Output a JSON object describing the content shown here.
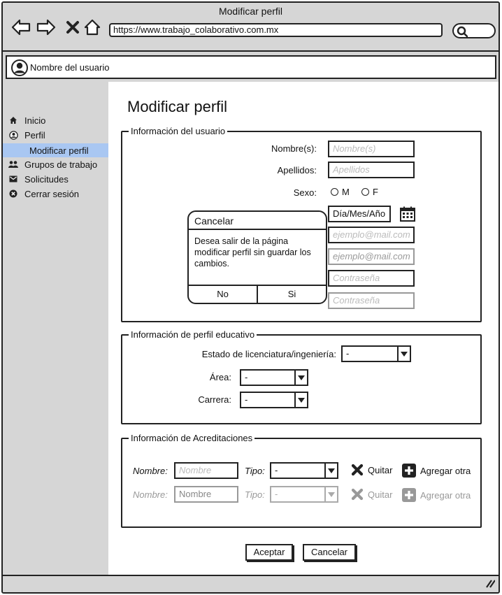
{
  "window": {
    "title": "Modificar perfil",
    "url": "https://www.trabajo_colaborativo.com.mx"
  },
  "user": {
    "name": "Nombre del usuario"
  },
  "sidebar": {
    "items": [
      {
        "label": "Inicio",
        "icon": "home-icon"
      },
      {
        "label": "Perfil",
        "icon": "user-circle-icon"
      },
      {
        "label": "Modificar perfil",
        "selected": true
      },
      {
        "label": "Grupos de trabajo",
        "icon": "group-icon"
      },
      {
        "label": "Solicitudes",
        "icon": "mail-icon"
      },
      {
        "label": "Cerrar sesión",
        "icon": "close-circle-icon"
      }
    ]
  },
  "main": {
    "title": "Modificar perfil",
    "user_info": {
      "legend": "Información del usuario",
      "nombre_label": "Nombre(s):",
      "nombre_placeholder": "Nombre(s)",
      "apellidos_label": "Apellidos:",
      "apellidos_placeholder": "Apellidos",
      "sexo_label": "Sexo:",
      "sexo_m": "M",
      "sexo_f": "F",
      "fecha_value": "Día/Mes/Año",
      "email_placeholder": "ejemplo@mail.com",
      "email_confirm_placeholder": "ejemplo@mail.com",
      "password_placeholder": "Contraseña",
      "password_confirm_placeholder": "Contraseña"
    },
    "edu_info": {
      "legend": "Información de perfil educativo",
      "estado_label": "Estado de licenciatura/ingeniería:",
      "estado_value": "-",
      "area_label": "Área:",
      "area_value": "-",
      "carrera_label": "Carrera:",
      "carrera_value": "-"
    },
    "acred_info": {
      "legend": "Información de Acreditaciones",
      "rows": [
        {
          "nombre_label": "Nombre:",
          "nombre_placeholder": "Nombre",
          "tipo_label": "Tipo:",
          "tipo_value": "-",
          "quitar": "Quitar",
          "agregar": "Agregar otra",
          "enabled": true
        },
        {
          "nombre_label": "Nombre:",
          "nombre_placeholder": "Nombre",
          "tipo_label": "Tipo:",
          "tipo_value": "-",
          "quitar": "Quitar",
          "agregar": "Agregar otra",
          "enabled": false
        }
      ]
    },
    "buttons": {
      "accept": "Aceptar",
      "cancel": "Cancelar"
    }
  },
  "modal": {
    "title": "Cancelar",
    "message": "Desea salir de la página modificar perfil sin guardar los cambios.",
    "no": "No",
    "yes": "Si"
  }
}
